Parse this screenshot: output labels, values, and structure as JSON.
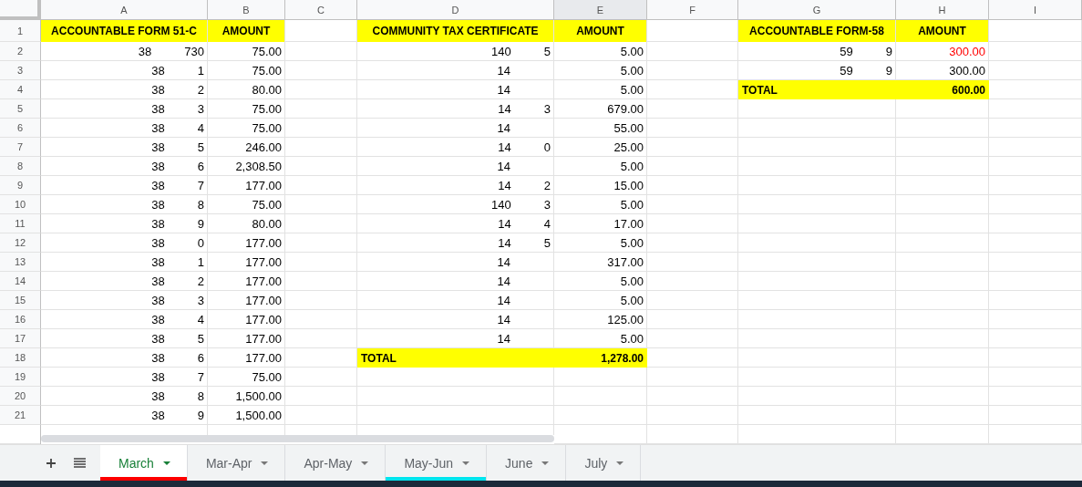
{
  "columns": [
    {
      "letter": "A",
      "selected": false
    },
    {
      "letter": "B",
      "selected": false
    },
    {
      "letter": "C",
      "selected": false
    },
    {
      "letter": "D",
      "selected": false
    },
    {
      "letter": "E",
      "selected": true
    },
    {
      "letter": "F",
      "selected": false
    },
    {
      "letter": "G",
      "selected": false
    },
    {
      "letter": "H",
      "selected": false
    },
    {
      "letter": "I",
      "selected": false
    }
  ],
  "row_numbers": [
    "1",
    "2",
    "3",
    "4",
    "5",
    "6",
    "7",
    "8",
    "9",
    "10",
    "11",
    "12",
    "13",
    "14",
    "15",
    "16",
    "17",
    "18",
    "19",
    "20",
    "21"
  ],
  "tables": [
    {
      "header": "ACCOUNTABLE FORM 51-C",
      "amount_header": "AMOUNT",
      "rows": [
        {
          "start": "38",
          "end": "730",
          "amount": "75.00"
        },
        {
          "start": "38",
          "end": "1",
          "amount": "75.00"
        },
        {
          "start": "38",
          "end": "2",
          "amount": "80.00"
        },
        {
          "start": "38",
          "end": "3",
          "amount": "75.00"
        },
        {
          "start": "38",
          "end": "4",
          "amount": "75.00"
        },
        {
          "start": "38",
          "end": "5",
          "amount": "246.00"
        },
        {
          "start": "38",
          "end": "6",
          "amount": "2,308.50"
        },
        {
          "start": "38",
          "end": "7",
          "amount": "177.00"
        },
        {
          "start": "38",
          "end": "8",
          "amount": "75.00"
        },
        {
          "start": "38",
          "end": "9",
          "amount": "80.00"
        },
        {
          "start": "38",
          "end": "0",
          "amount": "177.00"
        },
        {
          "start": "38",
          "end": "1",
          "amount": "177.00"
        },
        {
          "start": "38",
          "end": "2",
          "amount": "177.00"
        },
        {
          "start": "38",
          "end": "3",
          "amount": "177.00"
        },
        {
          "start": "38",
          "end": "4",
          "amount": "177.00"
        },
        {
          "start": "38",
          "end": "5",
          "amount": "177.00"
        },
        {
          "start": "38",
          "end": "6",
          "amount": "177.00"
        },
        {
          "start": "38",
          "end": "7",
          "amount": "75.00"
        },
        {
          "start": "38",
          "end": "8",
          "amount": "1,500.00"
        },
        {
          "start": "38",
          "end": "9",
          "amount": "1,500.00"
        }
      ]
    },
    {
      "header": "COMMUNITY TAX CERTIFICATE",
      "amount_header": "AMOUNT",
      "rows": [
        {
          "start": "140",
          "end": "5",
          "amount": "5.00"
        },
        {
          "start": "14",
          "amount": "5.00"
        },
        {
          "start": "14",
          "amount": "5.00"
        },
        {
          "start": "14",
          "end": "3",
          "amount": "679.00"
        },
        {
          "start": "14",
          "amount": "55.00"
        },
        {
          "start": "14",
          "end": "0",
          "amount": "25.00"
        },
        {
          "start": "14",
          "amount": "5.00"
        },
        {
          "start": "14",
          "end": "2",
          "amount": "15.00"
        },
        {
          "start": "140",
          "end": "3",
          "amount": "5.00"
        },
        {
          "start": "14",
          "end": "4",
          "amount": "17.00"
        },
        {
          "start": "14",
          "end": "5",
          "amount": "5.00"
        },
        {
          "start": "14",
          "amount": "317.00"
        },
        {
          "start": "14",
          "amount": "5.00"
        },
        {
          "start": "14",
          "amount": "5.00"
        },
        {
          "start": "14",
          "amount": "125.00"
        },
        {
          "start": "14",
          "amount": "5.00"
        }
      ],
      "total_label": "TOTAL",
      "total": "1,278.00"
    },
    {
      "header": "ACCOUNTABLE FORM-58",
      "amount_header": "AMOUNT",
      "rows": [
        {
          "start": "59",
          "end": "9",
          "amount": "300.00",
          "color": "#ff0000"
        },
        {
          "start": "59",
          "end": "9",
          "amount": "300.00",
          "color": "#000000"
        }
      ],
      "total_label": "TOTAL",
      "total": "600.00"
    }
  ],
  "sheet_tabs": [
    {
      "label": "March",
      "selected": true,
      "color": "#ff0000"
    },
    {
      "label": "Mar-Apr",
      "selected": false
    },
    {
      "label": "Apr-May",
      "selected": false
    },
    {
      "label": "May-Jun",
      "selected": false,
      "color": "#00e5ee"
    },
    {
      "label": "June",
      "selected": false
    },
    {
      "label": "July",
      "selected": false
    }
  ]
}
